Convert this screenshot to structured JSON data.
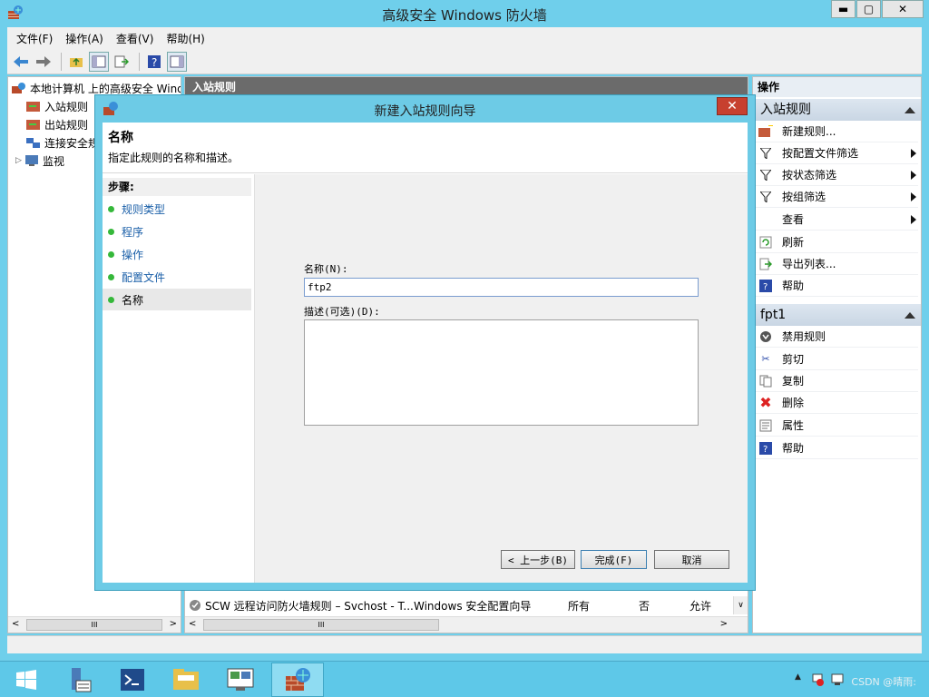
{
  "window": {
    "title": "高级安全 Windows 防火墙",
    "min_label": "▬",
    "max_label": "▢",
    "close_label": "✕"
  },
  "menu": [
    "文件(F)",
    "操作(A)",
    "查看(V)",
    "帮助(H)"
  ],
  "tree": {
    "root": "本地计算机 上的高级安全 Windows",
    "items": [
      "入站规则",
      "出站规则",
      "连接安全规则",
      "监视"
    ]
  },
  "middle": {
    "header": "入站规则",
    "row": {
      "name": "SCW 远程访问防火墙规则 – Svchost - T...",
      "group": "Windows 安全配置向导",
      "profile": "所有",
      "enabled": "否",
      "action": "允许"
    },
    "scroll_mark": "III"
  },
  "actions": {
    "head": "操作",
    "section1": "入站规则",
    "items1": [
      "新建规则...",
      "按配置文件筛选",
      "按状态筛选",
      "按组筛选",
      "查看",
      "刷新",
      "导出列表...",
      "帮助"
    ],
    "section2": "fpt1",
    "items2": [
      "禁用规则",
      "剪切",
      "复制",
      "删除",
      "属性",
      "帮助"
    ]
  },
  "dialog": {
    "title": "新建入站规则向导",
    "close_label": "✕",
    "heading": "名称",
    "subheading": "指定此规则的名称和描述。",
    "steps_title": "步骤:",
    "steps": [
      "规则类型",
      "程序",
      "操作",
      "配置文件",
      "名称"
    ],
    "name_label": "名称(N):",
    "name_value": "ftp2",
    "desc_label": "描述(可选)(D):",
    "back_label": "< 上一步(B)",
    "finish_label": "完成(F)",
    "cancel_label": "取消"
  },
  "taskbar": {
    "watermark": "CSDN @晴雨:"
  },
  "colors": {
    "titlebar": "#6fcfeb",
    "taskbar": "#5ec8e8",
    "close": "#c7402f",
    "step_dot": "#35b83a",
    "link": "#1a5fa8"
  },
  "icons": {
    "app": "firewall-icon",
    "back": "arrow-left-icon",
    "forward": "arrow-right-icon"
  }
}
